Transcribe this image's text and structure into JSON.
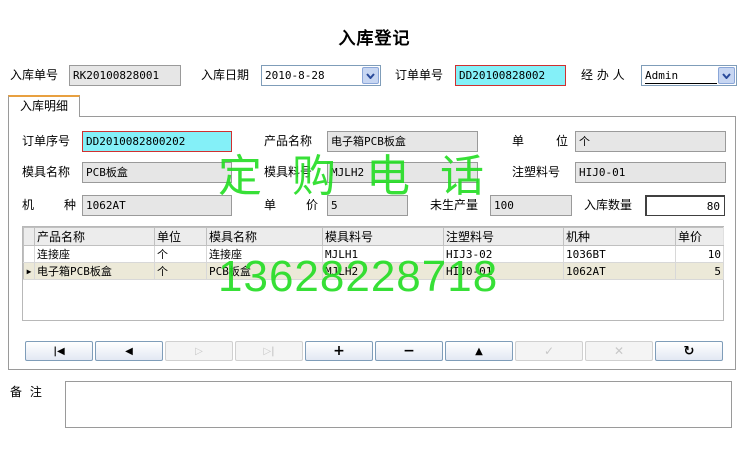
{
  "window": {
    "title": "入库登记"
  },
  "header": {
    "receipt_no_label": "入库单号",
    "receipt_no": "RK20100828001",
    "date_label": "入库日期",
    "date": "2010-8-28",
    "order_no_label": "订单单号",
    "order_no": "DD20100828002",
    "handler_label": "经 办 人",
    "handler": "Admin"
  },
  "tab": {
    "label": "入库明细"
  },
  "detail": {
    "order_seq_label": "订单序号",
    "order_seq": "DD2010082800202",
    "product_name_label": "产品名称",
    "product_name": "电子箱PCB板盒",
    "unit_label_1": "单",
    "unit_label_2": "位",
    "unit": "个",
    "mold_name_label": "模具名称",
    "mold_name": "PCB板盒",
    "mold_material_label": "模具料号",
    "mold_material": "MJLH2",
    "injection_material_label": "注塑料号",
    "injection_material": "HIJ0-01",
    "machine_label_1": "机",
    "machine_label_2": "种",
    "machine": "1062AT",
    "price_label_1": "单",
    "price_label_2": "价",
    "price": "5",
    "unproduced_label": "未生产量",
    "unproduced": "100",
    "in_qty_label": "入库数量",
    "in_qty": "80"
  },
  "grid": {
    "columns": [
      "产品名称",
      "单位",
      "模具名称",
      "模具料号",
      "注塑料号",
      "机种",
      "单价"
    ],
    "rows": [
      {
        "indicator": "",
        "cells": [
          "连接座",
          "个",
          "连接座",
          "MJLH1",
          "HIJ3-02",
          "1036BT",
          "10"
        ]
      },
      {
        "indicator": "▶",
        "cells": [
          "电子箱PCB板盒",
          "个",
          "PCB板盒",
          "MJLH2",
          "HIJ0-01",
          "1062AT",
          "5"
        ]
      }
    ]
  },
  "navigator": {
    "buttons": [
      {
        "name": "first-record-button",
        "icon": "first-icon",
        "glyph": "|◀",
        "enabled": true
      },
      {
        "name": "prior-record-button",
        "icon": "prior-icon",
        "glyph": "◀",
        "enabled": true
      },
      {
        "name": "next-record-button",
        "icon": "next-icon",
        "glyph": "▷",
        "enabled": false
      },
      {
        "name": "last-record-button",
        "icon": "last-icon",
        "glyph": "▷|",
        "enabled": false
      },
      {
        "name": "insert-record-button",
        "icon": "plus-icon",
        "glyph": "+",
        "enabled": true
      },
      {
        "name": "delete-record-button",
        "icon": "minus-icon",
        "glyph": "−",
        "enabled": true
      },
      {
        "name": "edit-record-button",
        "icon": "triangle-up-icon",
        "glyph": "▲",
        "enabled": true
      },
      {
        "name": "post-record-button",
        "icon": "check-icon",
        "glyph": "✓",
        "enabled": false
      },
      {
        "name": "cancel-record-button",
        "icon": "x-icon",
        "glyph": "✕",
        "enabled": false
      },
      {
        "name": "refresh-record-button",
        "icon": "refresh-icon",
        "glyph": "↻",
        "enabled": true
      }
    ]
  },
  "memo": {
    "label": "备 注",
    "value": ""
  },
  "watermark": {
    "line1": "定 购 电 话",
    "line2": "13628228718",
    "color": "#22dd22"
  }
}
